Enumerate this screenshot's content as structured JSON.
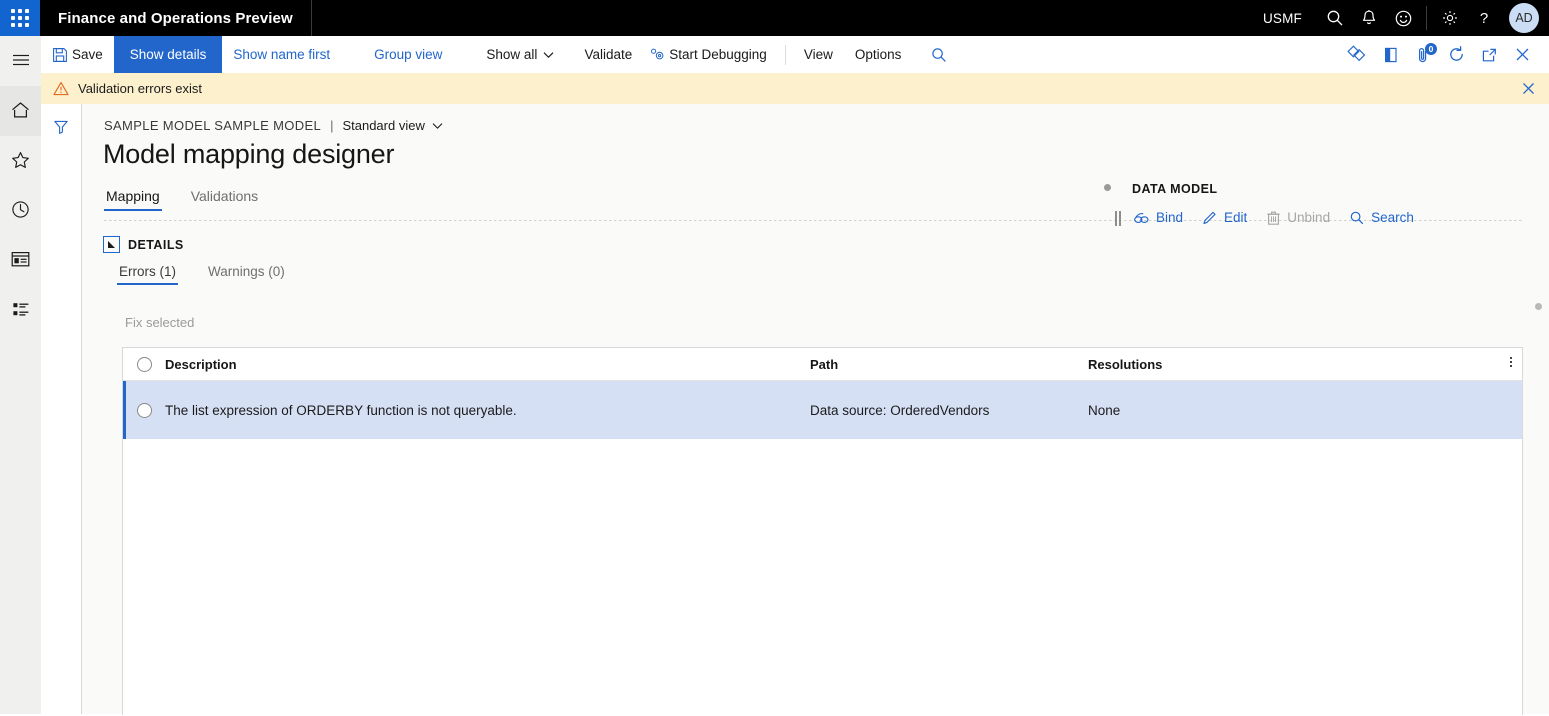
{
  "topnav": {
    "app_title": "Finance and Operations Preview",
    "company": "USMF",
    "icons": [
      "search-icon",
      "notifications-bell-icon",
      "feedback-smiley-icon",
      "settings-gear-icon",
      "help-question-icon"
    ],
    "avatar_initials": "AD"
  },
  "rail": {
    "items": [
      {
        "name": "hamburger-menu",
        "label": "Expand the navigation pane"
      },
      {
        "name": "home",
        "label": "Home"
      },
      {
        "name": "favorites-star",
        "label": "Favorites"
      },
      {
        "name": "recent-clock",
        "label": "Recent"
      },
      {
        "name": "workspaces",
        "label": "Workspaces"
      },
      {
        "name": "modules-list",
        "label": "Modules"
      }
    ]
  },
  "actionpane": {
    "save_label": "Save",
    "show_details_label": "Show details",
    "show_name_first_label": "Show name first",
    "group_view_label": "Group view",
    "show_all_label": "Show all",
    "validate_label": "Validate",
    "start_debugging_label": "Start Debugging",
    "view_label": "View",
    "options_label": "Options",
    "right_icons": [
      {
        "name": "personalize-diamond-icon"
      },
      {
        "name": "open-in-office-icon"
      },
      {
        "name": "attachments-icon",
        "badge": "0"
      },
      {
        "name": "refresh-icon"
      },
      {
        "name": "open-in-new-window-icon"
      },
      {
        "name": "close-page-icon"
      }
    ]
  },
  "messagebar": {
    "text": "Validation errors exist",
    "icon": "warning-triangle-icon",
    "close": "✕"
  },
  "filterstrip": {
    "icon": "filter-funnel-icon"
  },
  "breadcrumb": {
    "model": "SAMPLE MODEL SAMPLE MODEL",
    "separator": "|",
    "view": "Standard view"
  },
  "page": {
    "title": "Model mapping designer",
    "tabs": [
      {
        "label": "Mapping",
        "active": true
      },
      {
        "label": "Validations",
        "active": false
      }
    ]
  },
  "details": {
    "section_label": "DETAILS",
    "expander_glyph": "◢",
    "subtabs": [
      {
        "label": "Errors (1)",
        "active": true
      },
      {
        "label": "Warnings (0)",
        "active": false
      }
    ],
    "fix_selected_label": "Fix selected"
  },
  "grid": {
    "columns": [
      "Description",
      "Path",
      "Resolutions"
    ],
    "rows": [
      {
        "description": "The list expression of ORDERBY function is not queryable.",
        "path": "Data source: OrderedVendors",
        "resolutions": "None",
        "selected": true
      }
    ],
    "overflow_menu": "grid-options-kebab"
  },
  "datamodel": {
    "title": "DATA MODEL",
    "actions": [
      {
        "label": "Bind",
        "icon": "bind-link-icon",
        "disabled": false
      },
      {
        "label": "Edit",
        "icon": "edit-pencil-icon",
        "disabled": false
      },
      {
        "label": "Unbind",
        "icon": "unbind-trash-icon",
        "disabled": true
      },
      {
        "label": "Search",
        "icon": "search-magnifier-icon",
        "disabled": false
      }
    ]
  },
  "colors": {
    "brand_blue": "#2266CC",
    "topnav_black": "#000000",
    "warning_bg": "#FDF1CD",
    "selected_row": "#D6E0F5",
    "content_bg": "#FAFAF9"
  }
}
